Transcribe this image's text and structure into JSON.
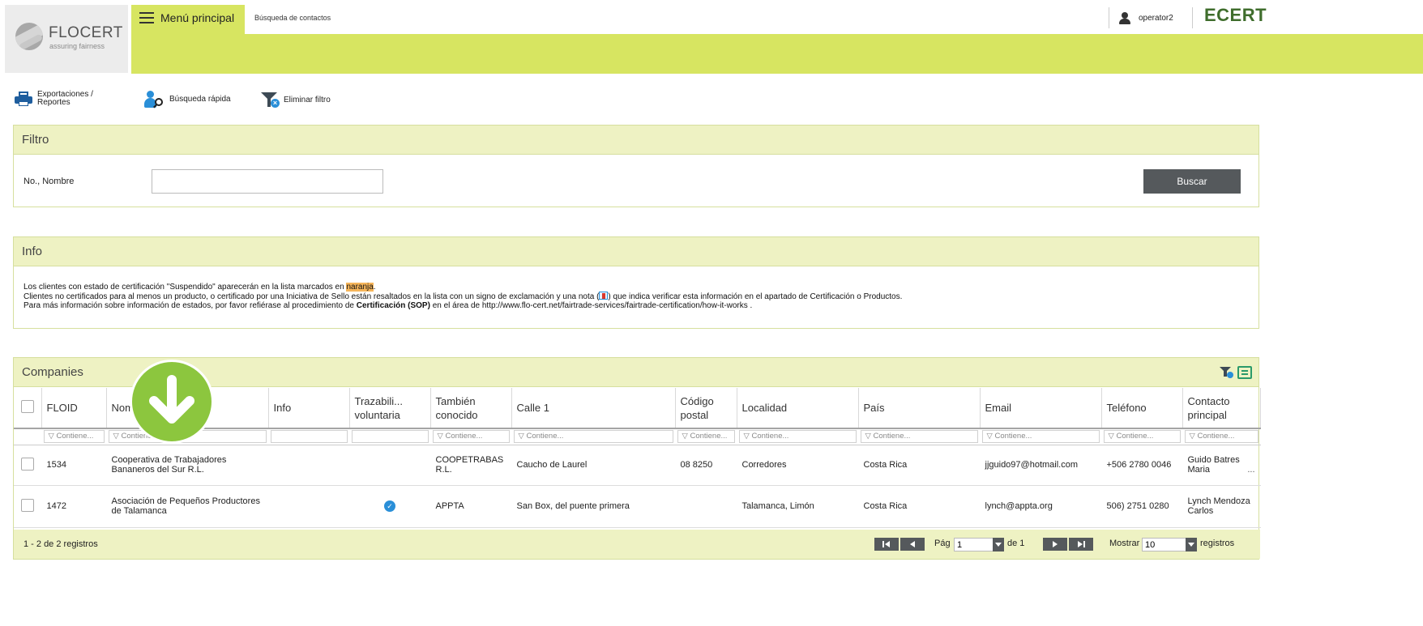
{
  "header": {
    "logo_name": "FLOCERT",
    "logo_tagline": "assuring fairness",
    "menu_label": "Menú principal",
    "breadcrumb": "Búsqueda de contactos",
    "user": "operator2",
    "brand": "ECERT"
  },
  "toolbar": {
    "exports_line1": "Exportaciones /",
    "exports_line2": "Reportes",
    "quick_search": "Búsqueda rápida",
    "remove_filter": "Eliminar filtro"
  },
  "filter": {
    "title": "Filtro",
    "field_label": "No., Nombre",
    "field_value": "",
    "button": "Buscar"
  },
  "info": {
    "title": "Info",
    "line1_pre": "Los clientes con estado de certificación \"Suspendido\" aparecerán en la lista marcados en",
    "line1_highlight": "naranja",
    "line1_post": ".",
    "line2_pre": "Clientes no certificados para al menos un producto, o certificado por una Iniciativa de Sello están resaltados en la lista con un signo de exclamación y una nota (",
    "line2_post": ") que indica verificar esta información en el apartado de Certificación o Productos.",
    "line3_pre": "Para más información sobre información de estados, por favor refiérase al procedimiento de",
    "line3_bold": "Certificación (SOP)",
    "line3_post": "en el área de http://www.flo-cert.net/fairtrade-services/fairtrade-certification/how-it-works ."
  },
  "companies": {
    "title": "Companies",
    "columns": [
      "FLOID",
      "Nombre",
      "Info",
      "Trazabili... voluntaria",
      "También conocido",
      "Calle 1",
      "Código postal",
      "Localidad",
      "País",
      "Email",
      "Teléfono",
      "Contacto principal"
    ],
    "filter_placeholder": "Contiene...",
    "rows": [
      {
        "floid": "1534",
        "name": "Cooperativa de Trabajadores Bananeros del Sur R.L.",
        "info": "",
        "traceability": false,
        "also_known": "COOPETRABAS R.L.",
        "street": "Caucho de Laurel",
        "postal": "08 8250",
        "locality": "Corredores",
        "country": "Costa Rica",
        "email": "jjguido97@hotmail.com",
        "phone": "+506 2780 0046",
        "contact": "Guido Batres Maria",
        "contact_more": "..."
      },
      {
        "floid": "1472",
        "name": "Asociación de Pequeños Productores de Talamanca",
        "info": "",
        "traceability": true,
        "also_known": "APPTA",
        "street": "San Box, del puente primera",
        "postal": "",
        "locality": "Talamanca, Limón",
        "country": "Costa Rica",
        "email": "lynch@appta.org",
        "phone": "506) 2751 0280",
        "contact": "Lynch Mendoza Carlos",
        "contact_more": ""
      }
    ],
    "pager": {
      "count": "1 - 2 de 2 registros",
      "page_label": "Pág",
      "page_value": "1",
      "of_label": "de 1",
      "show_label": "Mostrar",
      "show_value": "10",
      "records_label": "registros"
    }
  },
  "colors": {
    "header_green": "#d7e561",
    "panel_head": "#eef2c3",
    "overlay_green": "#8cc63e",
    "button_dark": "#55595c",
    "suspended_orange": "#f6b55a"
  }
}
